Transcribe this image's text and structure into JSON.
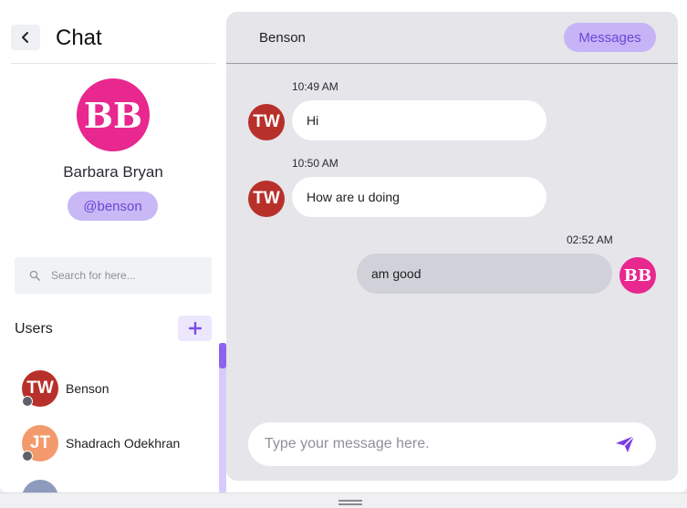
{
  "sidebar": {
    "title": "Chat",
    "profile": {
      "initials": "BB",
      "name": "Barbara Bryan",
      "handle": "@benson",
      "avatar_color": "#e8278f"
    },
    "search": {
      "placeholder": "Search for here..."
    },
    "users_heading": "Users",
    "users": [
      {
        "initials": "TW",
        "name": "Benson",
        "avatar_color": "#b8302a",
        "status": "offline"
      },
      {
        "initials": "JT",
        "name": "Shadrach Odekhran",
        "avatar_color": "#f39a6c",
        "status": "offline"
      },
      {
        "initials": "",
        "name": "",
        "avatar_color": "#8e9bbd",
        "status": "offline"
      }
    ]
  },
  "chat": {
    "contact_name": "Benson",
    "messages_button": "Messages",
    "messages": [
      {
        "time": "10:49 AM",
        "text": "Hi",
        "direction": "incoming",
        "avatar": "TW"
      },
      {
        "time": "10:50 AM",
        "text": "How are u doing",
        "direction": "incoming",
        "avatar": "TW"
      },
      {
        "time": "02:52 AM",
        "text": "am good",
        "direction": "outgoing",
        "avatar": "BB"
      }
    ],
    "composer": {
      "placeholder": "Type your message here."
    }
  },
  "colors": {
    "accent": "#8b63f0",
    "accent_light": "#c6b4f6",
    "panel_bg": "#e5e5ea"
  },
  "icons": [
    "chevron-left-icon",
    "search-icon",
    "plus-icon",
    "send-icon"
  ]
}
